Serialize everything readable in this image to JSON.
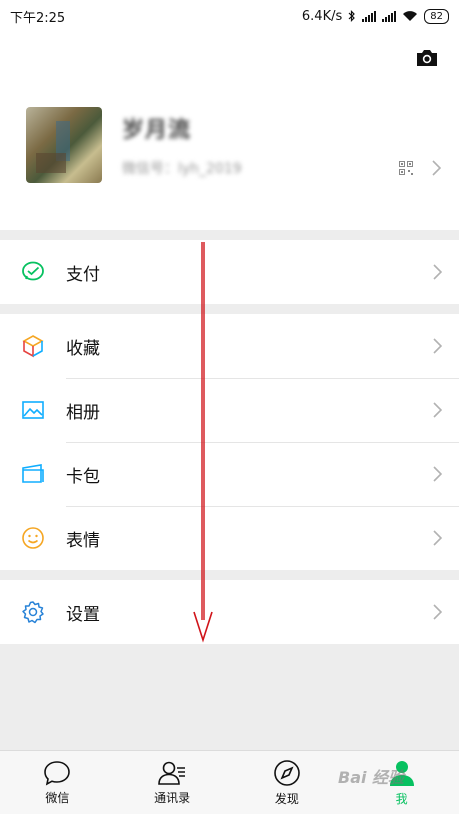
{
  "status_bar": {
    "time": "下午2:25",
    "net_speed": "6.4K/s",
    "battery": "82"
  },
  "profile": {
    "nickname": "岁月流",
    "wechat_id": "微信号：lyh_2019"
  },
  "menu_groups": [
    {
      "items": [
        {
          "label": "支付",
          "icon": "wechat-pay-icon"
        }
      ]
    },
    {
      "items": [
        {
          "label": "收藏",
          "icon": "favorites-cube-icon"
        },
        {
          "label": "相册",
          "icon": "album-photo-icon"
        },
        {
          "label": "卡包",
          "icon": "card-wallet-icon"
        },
        {
          "label": "表情",
          "icon": "sticker-smile-icon"
        }
      ]
    },
    {
      "items": [
        {
          "label": "设置",
          "icon": "settings-gear-icon"
        }
      ]
    }
  ],
  "tabbar": {
    "tabs": [
      {
        "label": "微信",
        "icon": "chat-bubble-icon"
      },
      {
        "label": "通讯录",
        "icon": "contacts-icon"
      },
      {
        "label": "发现",
        "icon": "compass-icon"
      },
      {
        "label": "我",
        "icon": "me-person-icon"
      }
    ],
    "active_index": 3
  },
  "colors": {
    "accent": "#07c160",
    "annotation_arrow": "#d0141a"
  },
  "watermark": "Bai 经验"
}
